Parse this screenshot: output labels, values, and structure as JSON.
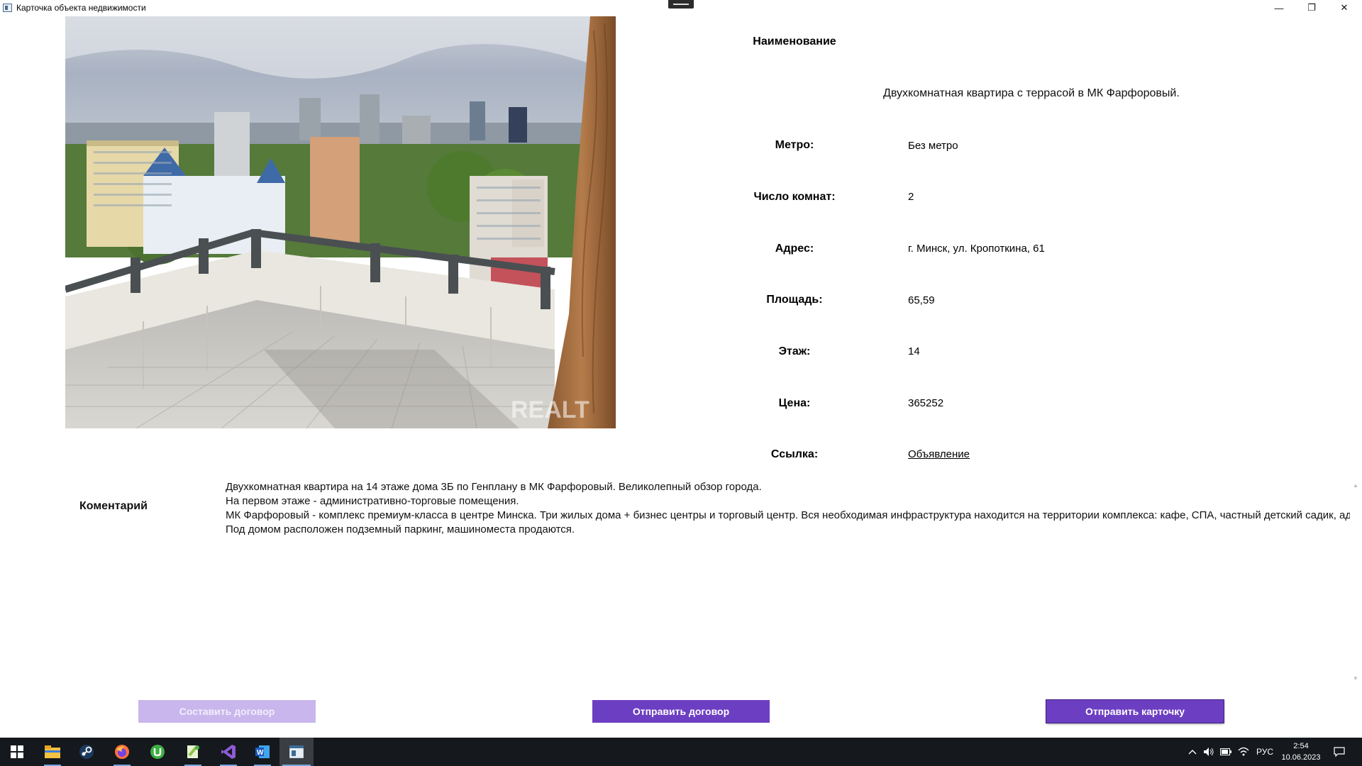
{
  "window": {
    "title": "Карточка объекта недвижимости",
    "minimize": "—",
    "maximize": "❐",
    "close": "✕"
  },
  "photo": {
    "watermark": "REALT"
  },
  "property": {
    "name_label": "Наименование",
    "name_value": "Двухкомнатная квартира с террасой в МК Фарфоровый.",
    "fields": [
      {
        "label": "Метро:",
        "value": "Без метро"
      },
      {
        "label": "Число комнат:",
        "value": "2"
      },
      {
        "label": "Адрес:",
        "value": "г. Минск, ул. Кропоткина, 61"
      },
      {
        "label": "Площадь:",
        "value": "65,59"
      },
      {
        "label": "Этаж:",
        "value": "14"
      },
      {
        "label": "Цена:",
        "value": "365252"
      },
      {
        "label": "Ссылка:",
        "value": "Объявление"
      }
    ]
  },
  "comment": {
    "label": "Коментарий",
    "lines": [
      "Двухкомнатная квартира на 14 этаже дома 3Б по Генплану в МК Фарфоровый. Великолепный обзор города.",
      "На первом этаже - административно-торговые помещения.",
      "МК Фарфоровый - комплекс премиум-класса в центре Минска. Три жилых дома + бизнес центры и торговый центр. Вся необходимая инфраструктура находится на территории комплекса: кафе, СПА, частный детский садик, адми",
      "Под домом расположен подземный паркинг, машиноместа продаются."
    ]
  },
  "buttons": {
    "make_contract": "Составить договор",
    "send_contract": "Отправить договор",
    "send_card": "Отправить карточку"
  },
  "taskbar": {
    "apps": [
      "windows-start-icon",
      "file-explorer-icon",
      "steam-icon",
      "firefox-icon",
      "utorrent-icon",
      "notepad-plus-plus-icon",
      "visual-studio-icon",
      "word-icon",
      "wpf-app-icon"
    ],
    "language": "РУС",
    "time": "2:54",
    "date": "10.06.2023"
  },
  "colors": {
    "accent": "#6c3fc2",
    "accent_disabled": "#c8b6ec",
    "taskbar": "#15181c"
  }
}
